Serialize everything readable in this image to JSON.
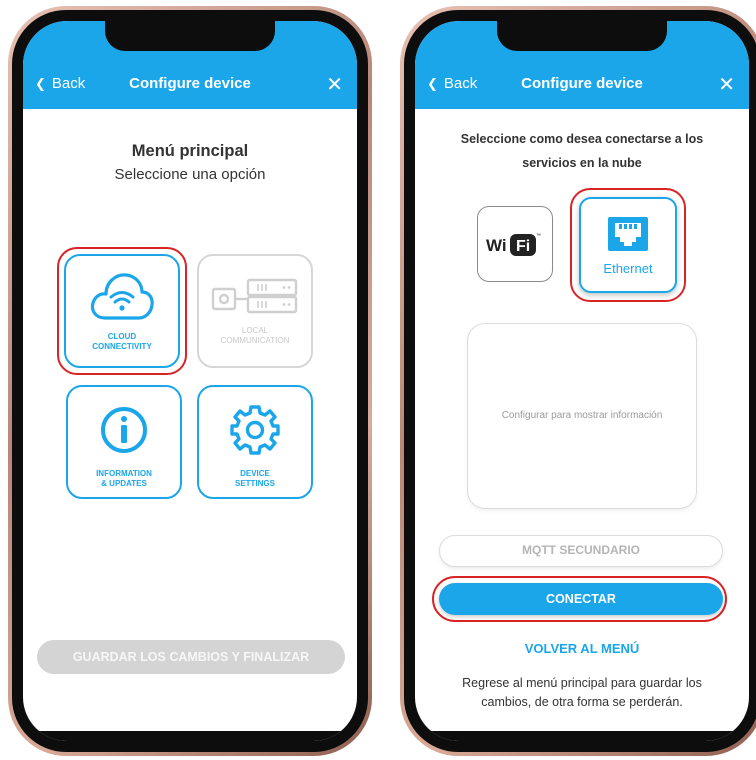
{
  "colors": {
    "accent": "#1ba6ea",
    "highlight_ring": "#d92426",
    "disabled": "#d4d4d4",
    "phone_frame": "#b88777"
  },
  "left_screen": {
    "header": {
      "back_label": "Back",
      "title": "Configure device",
      "close_icon": "close-icon"
    },
    "title": "Menú principal",
    "subtitle": "Seleccione una opción",
    "tiles": [
      {
        "label_line1": "CLOUD",
        "label_line2": "CONNECTIVITY",
        "icon": "cloud-wifi-icon",
        "enabled": true,
        "highlighted": true
      },
      {
        "label_line1": "LOCAL",
        "label_line2": "COMMUNICATION",
        "icon": "local-server-icon",
        "enabled": false,
        "highlighted": false
      },
      {
        "label_line1": "INFORMATION",
        "label_line2": "& UPDATES",
        "icon": "info-icon",
        "enabled": true,
        "highlighted": false
      },
      {
        "label_line1": "DEVICE",
        "label_line2": "SETTINGS",
        "icon": "gear-icon",
        "enabled": true,
        "highlighted": false
      }
    ],
    "save_button": "GUARDAR LOS CAMBIOS Y FINALIZAR"
  },
  "right_screen": {
    "header": {
      "back_label": "Back",
      "title": "Configure device",
      "close_icon": "close-icon"
    },
    "title_line1": "Seleccione como desea conectarse a los",
    "title_line2": "servicios en la nube",
    "options": {
      "wifi_logo_text": "Wi",
      "wifi_logo_box": "Fi",
      "ethernet_label": "Ethernet",
      "selected": "Ethernet"
    },
    "info_text": "Configurar para mostrar información",
    "mqtt_button": "MQTT SECUNDARIO",
    "connect_button": "CONECTAR",
    "back_menu_link": "VOLVER AL MENÚ",
    "note": "Regrese al menú principal para guardar los cambios, de otra forma se perderán."
  }
}
